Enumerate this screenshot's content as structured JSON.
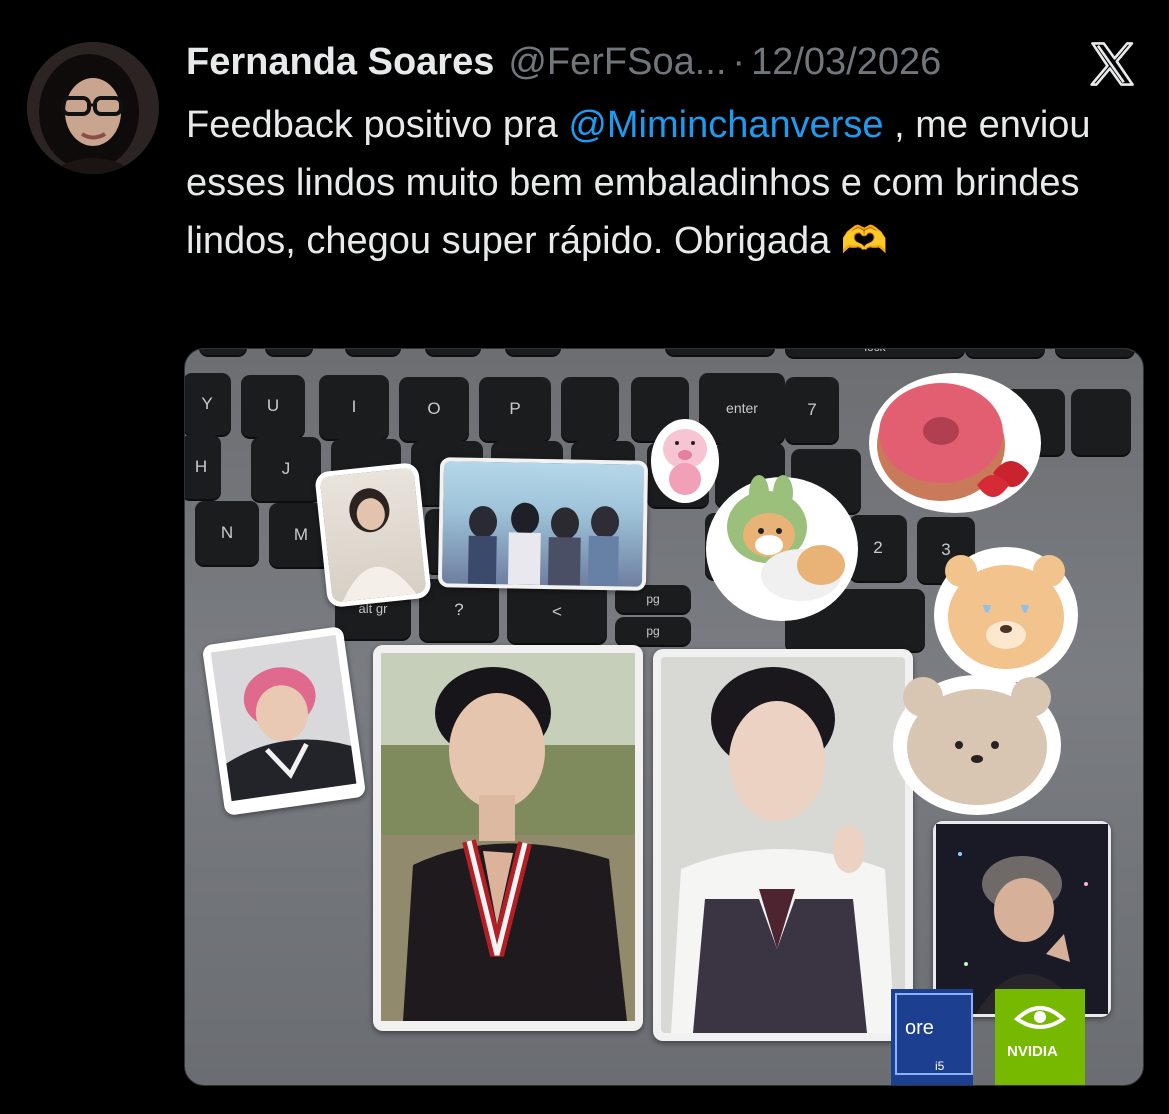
{
  "author": {
    "display_name": "Fernanda Soares",
    "handle": "@FerFSoa...",
    "separator": "·",
    "date": "12/03/2026"
  },
  "tweet": {
    "text_part1": "Feedback positivo pra ",
    "mention": "@Miminchanverse",
    "text_part2": " , me enviou esses lindos muito bem embaladinhos e com brindes lindos, chegou super rápido. Obrigada ",
    "emoji": "🫶"
  },
  "media": {
    "keys": [
      "Y",
      "U",
      "I",
      "O",
      "P",
      "enter",
      "7",
      "H",
      "J",
      "N",
      "M",
      "2",
      "3",
      "alt gr",
      "?",
      "<",
      "pg",
      "pg",
      "lock"
    ],
    "badges": {
      "intel": "ore",
      "intel_sub": "i5",
      "nvidia": "NVIDIA"
    }
  },
  "colors": {
    "background": "#000000",
    "text": "#e7e9ea",
    "muted": "#71767b",
    "mention": "#1d9bf0"
  },
  "icons": [
    "x-logo-icon",
    "heart-hands-emoji"
  ]
}
